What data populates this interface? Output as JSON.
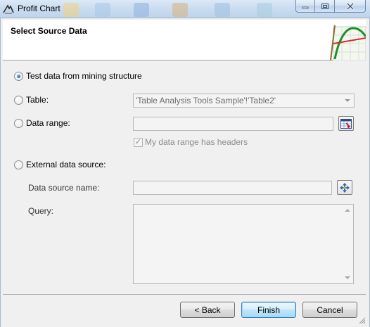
{
  "window": {
    "title": "Profit Chart",
    "app_icon": "analysis-tool-icon",
    "controls": {
      "minimize": "minimize-icon",
      "maximize": "maximize-icon",
      "close": "close-icon"
    }
  },
  "header": {
    "title": "Select Source Data",
    "graphic": "profit-chart-graphic"
  },
  "options": {
    "test_data": {
      "label": "Test data from mining structure",
      "selected": true
    },
    "table": {
      "label": "Table:",
      "selected": false,
      "value": "'Table Analysis Tools Sample'!'Table2'"
    },
    "data_range": {
      "label": "Data range:",
      "selected": false,
      "value": "",
      "picker_icon": "range-picker-icon",
      "headers_checkbox": {
        "label": "My data range has headers",
        "checked": true
      }
    },
    "external": {
      "label": "External data source:",
      "selected": false,
      "data_source_name": {
        "label": "Data source name:",
        "value": "",
        "picker_icon": "data-source-picker-icon"
      },
      "query": {
        "label": "Query:",
        "value": ""
      }
    }
  },
  "footer": {
    "back": "< Back",
    "finish": "Finish",
    "cancel": "Cancel"
  },
  "colors": {
    "titlebar": "#c9dcf0",
    "dialog_bg": "#f0f0f0",
    "radio_dot": "#2d6bb8",
    "default_button": "#bee6fd"
  }
}
